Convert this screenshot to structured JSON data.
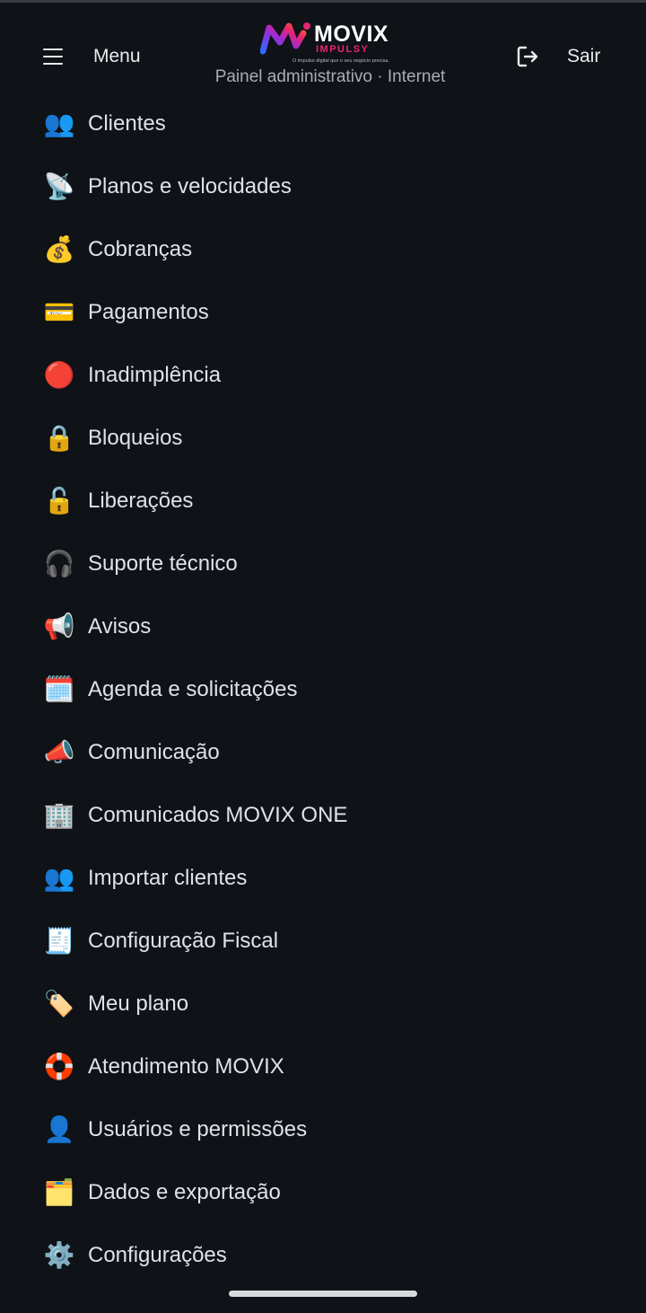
{
  "header": {
    "menu_label": "Menu",
    "logo_title": "MOVIX",
    "logo_sub": "IMPULSY",
    "logo_tagline": "O impulso digital que o seu negócio precisa.",
    "subtitle": "Painel administrativo · Internet",
    "logout_label": "Sair"
  },
  "nav": {
    "items": [
      {
        "label": "Clientes",
        "icon": "👥",
        "icon_name": "people-icon"
      },
      {
        "label": "Planos e velocidades",
        "icon": "📡",
        "icon_name": "satellite-dish-icon"
      },
      {
        "label": "Cobranças",
        "icon": "💰",
        "icon_name": "money-bag-icon"
      },
      {
        "label": "Pagamentos",
        "icon": "💳",
        "icon_name": "credit-card-icon"
      },
      {
        "label": "Inadimplência",
        "icon": "🔴",
        "icon_name": "red-circle-icon"
      },
      {
        "label": "Bloqueios",
        "icon": "🔒",
        "icon_name": "lock-icon"
      },
      {
        "label": "Liberações",
        "icon": "🔓",
        "icon_name": "unlock-icon"
      },
      {
        "label": "Suporte técnico",
        "icon": "🎧",
        "icon_name": "headphones-icon"
      },
      {
        "label": "Avisos",
        "icon": "📢",
        "icon_name": "loudspeaker-icon"
      },
      {
        "label": "Agenda e solicitações",
        "icon": "🗓️",
        "icon_name": "calendar-icon"
      },
      {
        "label": "Comunicação",
        "icon": "📣",
        "icon_name": "megaphone-icon"
      },
      {
        "label": "Comunicados MOVIX ONE",
        "icon": "🏢",
        "icon_name": "office-building-icon"
      },
      {
        "label": "Importar clientes",
        "icon": "👥",
        "icon_name": "people-icon"
      },
      {
        "label": "Configuração Fiscal",
        "icon": "🧾",
        "icon_name": "receipt-icon"
      },
      {
        "label": "Meu plano",
        "icon": "🏷️",
        "icon_name": "tag-icon"
      },
      {
        "label": "Atendimento MOVIX",
        "icon": "🛟",
        "icon_name": "lifebuoy-icon"
      },
      {
        "label": "Usuários e permissões",
        "icon": "👤",
        "icon_name": "user-icon"
      },
      {
        "label": "Dados e exportação",
        "icon": "🗂️",
        "icon_name": "card-index-dividers-icon"
      },
      {
        "label": "Configurações",
        "icon": "⚙️",
        "icon_name": "gear-icon"
      }
    ]
  },
  "colors": {
    "background": "#0f1217",
    "text": "#dfe2e6",
    "muted": "#a9adb4",
    "brand_pink": "#e8256f",
    "brand_orange": "#f26b2a",
    "brand_blue": "#2f6bff"
  }
}
